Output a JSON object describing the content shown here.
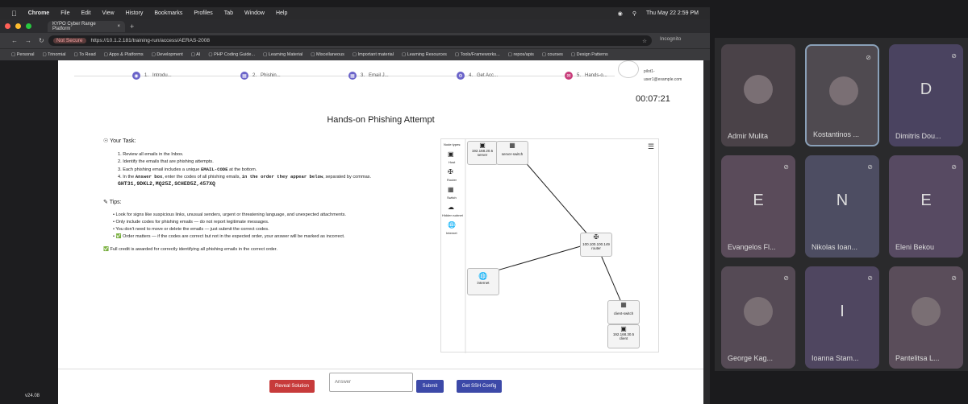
{
  "menubar": {
    "app": "Chrome",
    "items": [
      "File",
      "Edit",
      "View",
      "History",
      "Bookmarks",
      "Profiles",
      "Tab",
      "Window",
      "Help"
    ],
    "clock": "Thu May 22  2:59 PM"
  },
  "browser": {
    "tab_title": "KYPO Cyber Range Platform",
    "not_secure": "Not Secure",
    "url": "https://10.1.2.181/training-run/access/AERAS-2008",
    "incognito": "Incognito"
  },
  "bookmarks": [
    "Personal",
    "Trinomial",
    "To Read",
    "Apps & Platforms",
    "Development",
    "AI",
    "PHP Coding Guide...",
    "Learning Material",
    "Miscellaneous",
    "Important material",
    "Learning Resources",
    "Tools/Frameworks...",
    "repos/apis",
    "courses",
    "Design Patterns"
  ],
  "steps": [
    {
      "n": "1.",
      "label": "Introdu..."
    },
    {
      "n": "2.",
      "label": "Phishin..."
    },
    {
      "n": "3.",
      "label": "Email J..."
    },
    {
      "n": "4.",
      "label": "Get Acc..."
    },
    {
      "n": "5.",
      "label": "Hands-o..."
    }
  ],
  "user": {
    "name": "pilot1-",
    "email": "user1@example.com"
  },
  "timer": "00:07:21",
  "page_title": "Hands-on Phishing Attempt",
  "task": {
    "heading": "Your Task:",
    "items": [
      "1. Review all emails in the Inbox.",
      "2. Identify the emails that are phishing attempts.",
      "3. Each phishing email includes a unique",
      "4. In the"
    ],
    "code_label": "EMAIL-CODE",
    "item3_tail": "at the bottom.",
    "answer_box": "Answer box",
    "item4_mid": ", enter the codes of all phishing emails,",
    "order_text": "in the order they appear below",
    "item4_tail": ", separated by commas.",
    "codes": "GHT31,9DKL2,MQ25Z,SCHED5Z,457XQ"
  },
  "tips": {
    "heading": "Tips:",
    "items": [
      "Look for signs like suspicious links, unusual senders, urgent or threatening language, and unexpected attachments.",
      "Only include codes for phishing emails — do not report legitimate messages.",
      "You don't need to move or delete the emails — just submit the correct codes.",
      "Order matters — if the codes are correct but not in the expected order, your answer will be marked as incorrect."
    ]
  },
  "credit": "Full credit is awarded for correctly identifying all phishing emails in the correct order.",
  "topology": {
    "node_types_label": "Node types:",
    "types": [
      "Host",
      "Router",
      "Switch",
      "Hidden subnet",
      "Internet"
    ],
    "nodes": {
      "server_ip": "192.168.20.5",
      "server": "server",
      "server_switch": "server-switch",
      "router_ip": "100.100.100.149",
      "router": "router",
      "internet": "internet",
      "client_switch": "client-switch",
      "client_ip": "192.168.30.5",
      "client": "client"
    }
  },
  "actions": {
    "reveal": "Reveal Solution",
    "answer_placeholder": "Answer",
    "submit": "Submit",
    "ssh": "Get SSH Config"
  },
  "version": "v24.08",
  "participants": [
    {
      "name": "Admir Mulita",
      "initial": ""
    },
    {
      "name": "Kostantinos ...",
      "initial": ""
    },
    {
      "name": "Dimitris Dou...",
      "initial": "D"
    },
    {
      "name": "Evangelos Fl...",
      "initial": "E"
    },
    {
      "name": "Nikolas Ioan...",
      "initial": "N"
    },
    {
      "name": "Eleni Bekou",
      "initial": "E"
    },
    {
      "name": "George Kag...",
      "initial": ""
    },
    {
      "name": "Ioanna Stam...",
      "initial": "I"
    },
    {
      "name": "Pantelitsa L...",
      "initial": ""
    }
  ]
}
